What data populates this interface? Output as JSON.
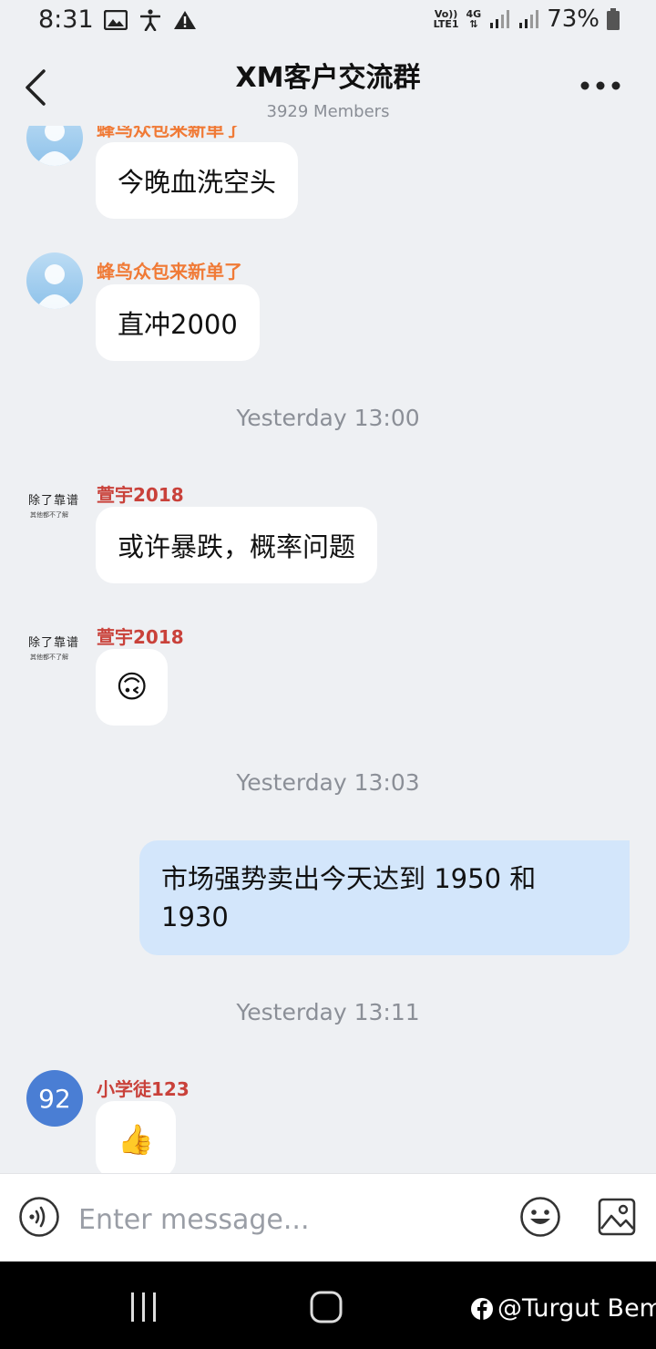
{
  "status_bar": {
    "time": "8:31",
    "net_top": "Vo))",
    "net_bottom": "LTE1",
    "gen": "4G",
    "battery": "73%"
  },
  "header": {
    "title": "XM客户交流群",
    "subtitle": "3929 Members"
  },
  "messages": [
    {
      "sender": "蜂鸟众包来新单了",
      "text": "今晚血洗空头"
    },
    {
      "sender": "蜂鸟众包来新单了",
      "text": "直冲2000"
    },
    {
      "timestamp": "Yesterday 13:00"
    },
    {
      "sender": "萱宇2018",
      "avatar_line1": "除了靠谱",
      "avatar_line2": "其他都不了解",
      "text": "或许暴跌，概率问题"
    },
    {
      "sender": "萱宇2018",
      "avatar_line1": "除了靠谱",
      "avatar_line2": "其他都不了解",
      "text": "🙃"
    },
    {
      "timestamp": "Yesterday 13:03"
    },
    {
      "mine": true,
      "text": "市场强势卖出今天达到 1950 和 1930"
    },
    {
      "timestamp": "Yesterday 13:11"
    },
    {
      "sender": "小学徒123",
      "avatar_text": "92",
      "text": "👍"
    }
  ],
  "colors": {
    "sender_orange": "#f07a36",
    "sender_red": "#c9413a",
    "my_bubble": "#d3e6fb",
    "avatar_blue": "#4a7ed4"
  },
  "input": {
    "placeholder": "Enter message..."
  },
  "icons": {
    "voice": "voice-input-icon",
    "emoji": "emoji-icon",
    "image": "image-icon"
  },
  "watermark": "@Turgut Bem"
}
